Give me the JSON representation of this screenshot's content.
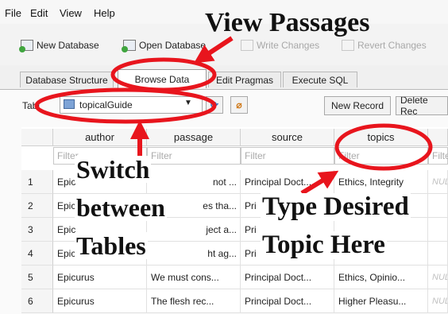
{
  "menubar": {
    "items": [
      "File",
      "Edit",
      "View",
      "Help"
    ]
  },
  "toolbar": {
    "new_database": "New Database",
    "open_database": "Open Database",
    "write_changes": "Write Changes",
    "revert_changes": "Revert Changes"
  },
  "tabs": [
    "Database Structure",
    "Browse Data",
    "Edit Pragmas",
    "Execute SQL"
  ],
  "browse": {
    "table_label": "Table:",
    "table_label_visible": "Tabl",
    "selected_table": "topicalGuide",
    "new_record": "New Record",
    "delete_record": "Delete Rec"
  },
  "grid": {
    "columns": [
      "author",
      "passage",
      "source",
      "topics"
    ],
    "filter_placeholder": "Filter",
    "rows": [
      {
        "num": "1",
        "author": "Epic",
        "passage": "not ...",
        "source": "Principal Doct...",
        "topics": "Ethics, Integrity",
        "extra": "NUL"
      },
      {
        "num": "2",
        "author": "Epic",
        "passage": "es tha...",
        "source": "Pri",
        "topics": "",
        "extra": ""
      },
      {
        "num": "3",
        "author": "Epic",
        "passage": "ject a...",
        "source": "Pri",
        "topics": "",
        "extra": ""
      },
      {
        "num": "4",
        "author": "Epic",
        "passage": "ht ag...",
        "source": "Pri",
        "topics": "",
        "extra": ""
      },
      {
        "num": "5",
        "author": "Epicurus",
        "passage": "We must cons...",
        "source": "Principal Doct...",
        "topics": "Ethics, Opinio...",
        "extra": "NUL"
      },
      {
        "num": "6",
        "author": "Epicurus",
        "passage": "The flesh rec...",
        "source": "Principal Doct...",
        "topics": "Higher Pleasu...",
        "extra": "NUL"
      }
    ]
  },
  "annotations": {
    "view_passages": "View Passages",
    "switch_tables_1": "Switch",
    "switch_tables_2": "between",
    "switch_tables_3": "Tables",
    "type_topic_1": "Type Desired",
    "type_topic_2": "Topic Here"
  },
  "colors": {
    "annotation_red": "#e8151d",
    "accent_green": "#3fa53f"
  }
}
